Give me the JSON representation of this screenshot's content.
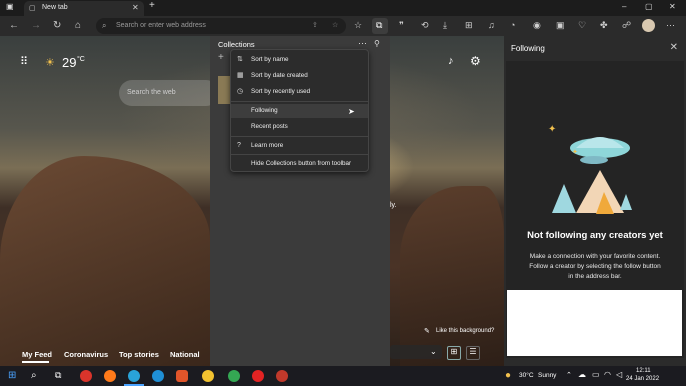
{
  "tab": {
    "title": "New tab"
  },
  "addressbar": {
    "placeholder": "Search or enter web address"
  },
  "newtab": {
    "temperature": "29",
    "temperature_unit": "°C",
    "search_placeholder": "Search the web",
    "feed_tabs": [
      "My Feed",
      "Coronavirus",
      "Top stories",
      "National"
    ],
    "like_background": "Like this background?",
    "partial_text": "ly."
  },
  "collections": {
    "title": "Collections",
    "menu": {
      "items": [
        {
          "icon": "sort-name-icon",
          "label": "Sort by name"
        },
        {
          "icon": "calendar-icon",
          "label": "Sort by date created"
        },
        {
          "icon": "clock-icon",
          "label": "Sort by recently used"
        },
        {
          "icon": "",
          "label": "Following",
          "highlighted": true
        },
        {
          "icon": "",
          "label": "Recent posts"
        },
        {
          "icon": "question-icon",
          "label": "Learn more"
        },
        {
          "icon": "",
          "label": "Hide Collections button from toolbar"
        }
      ]
    }
  },
  "following_panel": {
    "title": "Following",
    "empty_title": "Not following any creators yet",
    "desc_line1": "Make a connection with your favorite content.",
    "desc_line2": "Follow a creator by selecting the follow button",
    "desc_line3": "in the address bar."
  },
  "taskbar": {
    "weather_temp": "30°C",
    "weather_cond": "Sunny",
    "time": "12:11",
    "date": "24 Jan 2022"
  },
  "colors": {
    "menu_bg": "#2c2c2c",
    "panel_bg": "#2b2b2b",
    "accent_edge": "#0078d4"
  }
}
